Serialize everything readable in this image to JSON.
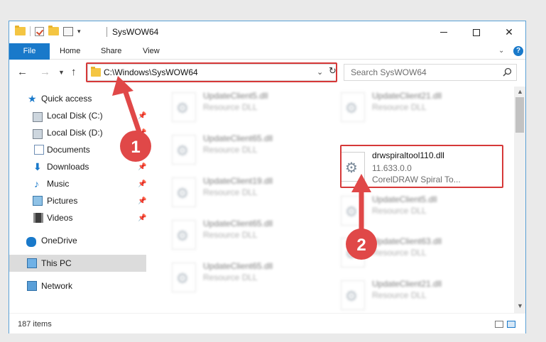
{
  "window": {
    "title": "SysWOW64"
  },
  "ribbon": {
    "tabs": [
      {
        "label": "File"
      },
      {
        "label": "Home"
      },
      {
        "label": "Share"
      },
      {
        "label": "View"
      }
    ]
  },
  "address": {
    "path": "C:\\Windows\\SysWOW64"
  },
  "search": {
    "placeholder": "Search SysWOW64"
  },
  "sidebar": {
    "items": [
      {
        "label": "Quick access",
        "icon": "star-icon",
        "pinned": false
      },
      {
        "label": "Local Disk (C:)",
        "icon": "drive-icon",
        "pinned": true
      },
      {
        "label": "Local Disk (D:)",
        "icon": "drive-icon",
        "pinned": true
      },
      {
        "label": "Documents",
        "icon": "documents-icon",
        "pinned": true
      },
      {
        "label": "Downloads",
        "icon": "download-icon",
        "pinned": true
      },
      {
        "label": "Music",
        "icon": "music-icon",
        "pinned": true
      },
      {
        "label": "Pictures",
        "icon": "pictures-icon",
        "pinned": true
      },
      {
        "label": "Videos",
        "icon": "videos-icon",
        "pinned": true
      },
      {
        "label": "OneDrive",
        "icon": "onedrive-icon",
        "pinned": false
      },
      {
        "label": "This PC",
        "icon": "this-pc-icon",
        "pinned": false,
        "selected": true
      },
      {
        "label": "Network",
        "icon": "network-icon",
        "pinned": false
      }
    ]
  },
  "files": {
    "left_column": [
      {
        "name": "UpdateClient5.dll",
        "type": "Resource DLL"
      },
      {
        "name": "UpdateClient65.dll",
        "type": "Resource DLL"
      },
      {
        "name": "UpdateClient19.dll",
        "type": "Resource DLL"
      },
      {
        "name": "UpdateClient65.dll",
        "type": "Resource DLL"
      },
      {
        "name": "UpdateClient65.dll",
        "type": "Resource DLL"
      }
    ],
    "right_column": [
      {
        "name": "UpdateClient21.dll",
        "type": "Resource DLL"
      },
      {
        "name": "drwspiraltool110.dll",
        "version": "11.633.0.0",
        "description": "CorelDRAW Spiral To...",
        "highlighted": true
      },
      {
        "name": "UpdateClient5.dll",
        "type": "Resource DLL"
      },
      {
        "name": "UpdateClient63.dll",
        "type": "Resource DLL"
      },
      {
        "name": "UpdateClient21.dll",
        "type": "Resource DLL"
      }
    ]
  },
  "status": {
    "item_count": "187 items"
  },
  "annotations": {
    "step1": "1",
    "step2": "2",
    "color": "#e04848"
  },
  "colors": {
    "accent": "#1979ca",
    "highlight": "#d63838",
    "selected_bg": "#dcdcdc"
  }
}
